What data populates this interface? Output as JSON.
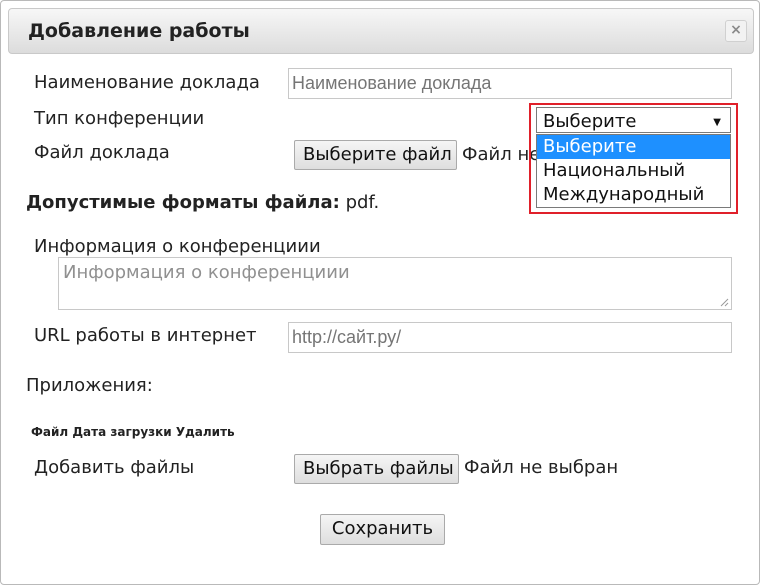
{
  "dialog": {
    "title": "Добавление работы",
    "close_glyph": "×"
  },
  "form": {
    "report_name_label": "Наименование доклада",
    "report_name_placeholder": "Наименование доклада",
    "conf_type_label": "Тип конференции",
    "conf_type_selected": "Выберите",
    "conf_type_options": [
      "Выберите",
      "Национальный",
      "Международный"
    ],
    "report_file_label": "Файл доклада",
    "report_file_button": "Выберите файл",
    "report_file_status": "Файл не выбран",
    "formats_label": "Допустимые форматы файла:",
    "formats_value": "pdf.",
    "conf_info_label": "Информация о конференциии",
    "conf_info_placeholder": "Информация о конференциии",
    "url_label": "URL работы в интернет",
    "url_placeholder": "http://сайт.ру/",
    "attachments_label": "Приложения:",
    "attachments_columns": "Файл Дата загрузки Удалить",
    "add_files_label": "Добавить файлы",
    "add_files_button": "Выбрать файлы",
    "add_files_status": "Файл не выбран",
    "save_button": "Сохранить"
  },
  "colors": {
    "highlight": "#1e90ff",
    "annotation": "#e0202a"
  }
}
